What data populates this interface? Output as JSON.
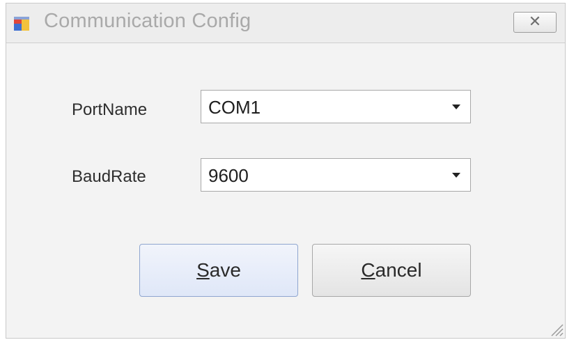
{
  "window": {
    "title": "Communication Config",
    "icon": "app-window-icon",
    "close_label": "✕"
  },
  "form": {
    "port": {
      "label": "PortName",
      "value": "COM1"
    },
    "baud": {
      "label": "BaudRate",
      "value": "9600"
    }
  },
  "buttons": {
    "save": {
      "mnemonic": "S",
      "rest": "ave"
    },
    "cancel": {
      "mnemonic": "C",
      "rest": "ancel"
    }
  },
  "colors": {
    "accent": "#dfe7f8",
    "title_text": "#a9a9a9"
  }
}
